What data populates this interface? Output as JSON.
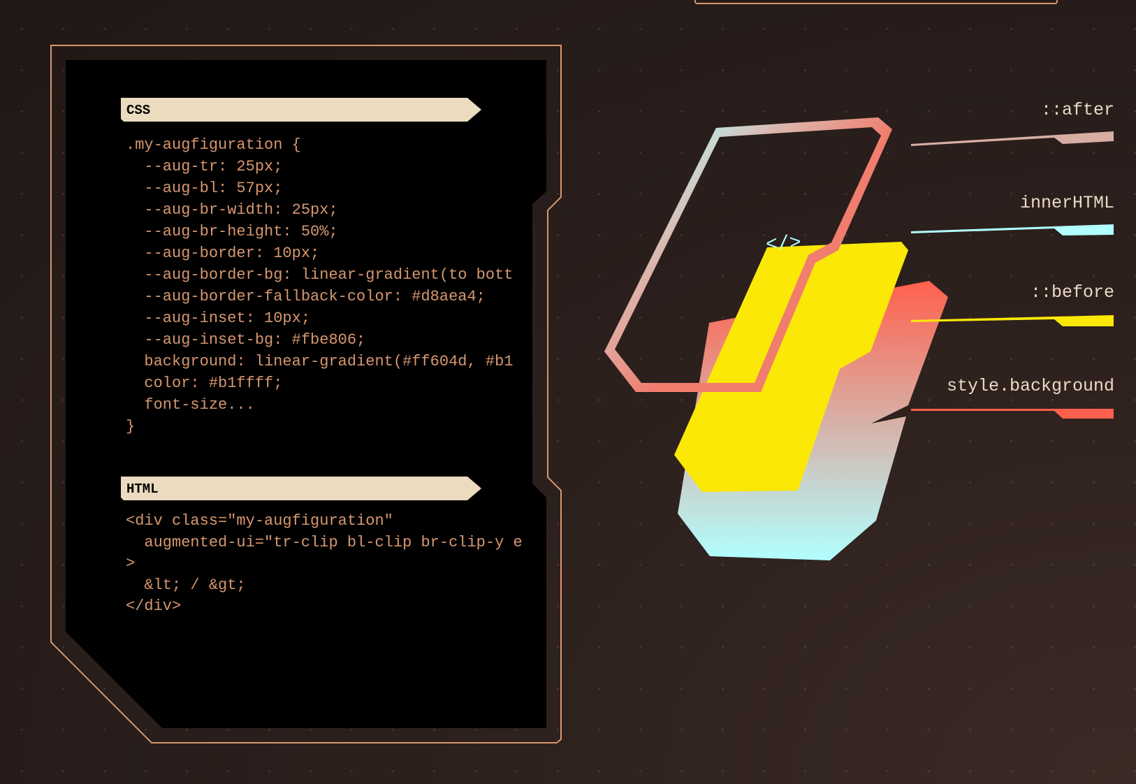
{
  "css_section": {
    "title": "CSS",
    "lines": [
      ".my-augfiguration {",
      "  --aug-tr: 25px;",
      "  --aug-bl: 57px;",
      "  --aug-br-width: 25px;",
      "  --aug-br-height: 50%;",
      "  --aug-border: 10px;",
      "  --aug-border-bg: linear-gradient(to bott",
      "  --aug-border-fallback-color: #d8aea4;",
      "  --aug-inset: 10px;",
      "  --aug-inset-bg: #fbe806;",
      "  background: linear-gradient(#ff604d, #b1",
      "  color: #b1ffff;",
      "  font-size...",
      "}"
    ]
  },
  "html_section": {
    "title": "HTML",
    "lines": [
      "<div class=\"my-augfiguration\"",
      "  augmented-ui=\"tr-clip bl-clip br-clip-y e",
      ">",
      "  &lt; / &gt;",
      "</div>"
    ]
  },
  "diagram": {
    "inner_glyph": "</>",
    "labels": [
      {
        "text": "::after",
        "color": "#d8aea4"
      },
      {
        "text": "innerHTML",
        "color": "#b1ffff"
      },
      {
        "text": "::before",
        "color": "#fbe806"
      },
      {
        "text": "style.background",
        "color": "#ff604d"
      }
    ]
  },
  "colors": {
    "accent": "#d7976f",
    "tag_bg": "#ebdcbf",
    "gradient_top": "#ff604d",
    "gradient_bottom": "#b1ffff",
    "inset": "#fbe806",
    "border_fallback": "#d8aea4"
  }
}
